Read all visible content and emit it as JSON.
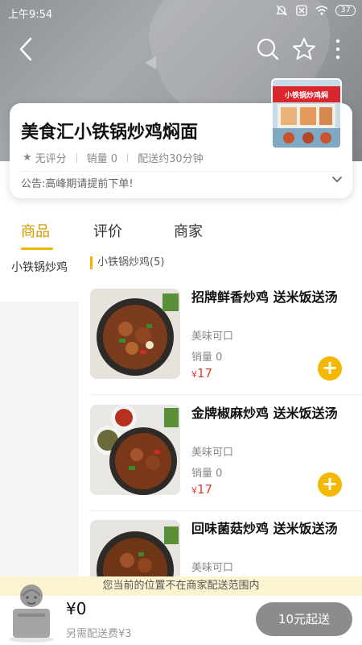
{
  "status_bar": {
    "time": "上午9:54",
    "battery": "37"
  },
  "shop": {
    "name": "美食汇小铁锅炒鸡焖面",
    "rating": "无评分",
    "sales": "销量 0",
    "delivery": "配送约30分钟",
    "notice": "公告:高峰期请提前下单!",
    "sign_text": "小铁锅炒鸡焖"
  },
  "tabs": [
    {
      "label": "商品",
      "active": true
    },
    {
      "label": "评价",
      "active": false
    },
    {
      "label": "商家",
      "active": false
    }
  ],
  "sidebar": {
    "items": [
      {
        "label": "小铁锅炒鸡"
      }
    ]
  },
  "category": {
    "title": "小铁锅炒鸡(5)"
  },
  "dishes": [
    {
      "name": "招牌鲜香炒鸡 送米饭送汤",
      "desc": "美味可口",
      "sales": "销量 0",
      "price_symbol": "¥",
      "price": "17"
    },
    {
      "name": "金牌椒麻炒鸡 送米饭送汤",
      "desc": "美味可口",
      "sales": "销量 0",
      "price_symbol": "¥",
      "price": "17"
    },
    {
      "name": "回味菌菇炒鸡 送米饭送汤",
      "desc": "美味可口",
      "sales": "",
      "price_symbol": "",
      "price": ""
    }
  ],
  "warning": "您当前的位置不在商家配送范围内",
  "cart": {
    "total": "¥0",
    "fee": "另需配送费¥3",
    "checkout": "10元起送"
  },
  "colors": {
    "accent": "#f2b300",
    "price": "#e23b2e",
    "checkout_bg": "#8c8c8c"
  }
}
